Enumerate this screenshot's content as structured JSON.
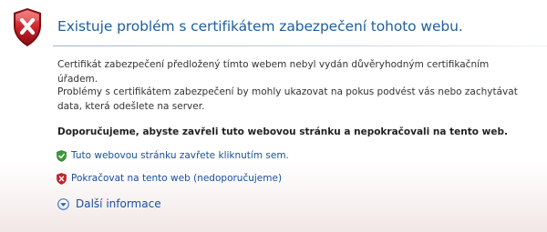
{
  "header": {
    "title": "Existuje problém s certifikátem zabezpečení tohoto webu.",
    "shield_icon": "red-shield-x-icon"
  },
  "body": {
    "paragraph1": "Certifikát zabezpečení předložený tímto webem nebyl vydán důvěryhodným certifikačním úřadem.",
    "paragraph2": "Problémy s certifikátem zabezpečení by mohly ukazovat na pokus podvést vás nebo zachytávat data, která odešlete na server.",
    "recommendation": "Doporučujeme, abyste zavřeli tuto webovou stránku a nepokračovali na tento web."
  },
  "actions": {
    "close_page": {
      "label": "Tuto webovou stránku zavřete kliknutím sem.",
      "icon": "green-shield-check-icon"
    },
    "continue": {
      "label": "Pokračovat na tento web (nedoporučujeme)",
      "icon": "red-shield-x-icon"
    }
  },
  "more_info": {
    "label": "Další informace",
    "icon": "chevron-down-circle-icon"
  },
  "colors": {
    "title": "#1f5e9a",
    "link": "#1a4fa0",
    "danger": "#c8222a",
    "safe": "#3a9a3a"
  }
}
